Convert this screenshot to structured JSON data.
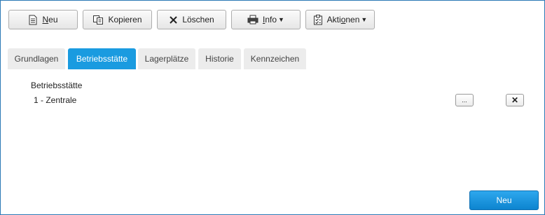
{
  "toolbar": {
    "new": {
      "pre": "",
      "u": "N",
      "post": "eu",
      "icon": "document-icon"
    },
    "copy": {
      "label": "Kopieren",
      "icon": "copy-icon"
    },
    "delete": {
      "label": "Löschen",
      "icon": "x-icon"
    },
    "info": {
      "pre": "",
      "u": "I",
      "post": "nfo",
      "icon": "printer-icon",
      "caret": "▼"
    },
    "actions": {
      "pre": "Akti",
      "u": "o",
      "post": "nen",
      "icon": "checklist-icon",
      "caret": "▼"
    }
  },
  "tabs": [
    {
      "label": "Grundlagen",
      "active": false
    },
    {
      "label": "Betriebsstätte",
      "active": true
    },
    {
      "label": "Lagerplätze",
      "active": false
    },
    {
      "label": "Historie",
      "active": false
    },
    {
      "label": "Kennzeichen",
      "active": false
    }
  ],
  "section": {
    "title": "Betriebsstätte",
    "value": "1 - Zentrale",
    "browse_label": "...",
    "clear_label": "✕"
  },
  "footer": {
    "new_label": "Neu"
  },
  "colors": {
    "accent": "#1a9be0",
    "border": "#2b79b6"
  }
}
